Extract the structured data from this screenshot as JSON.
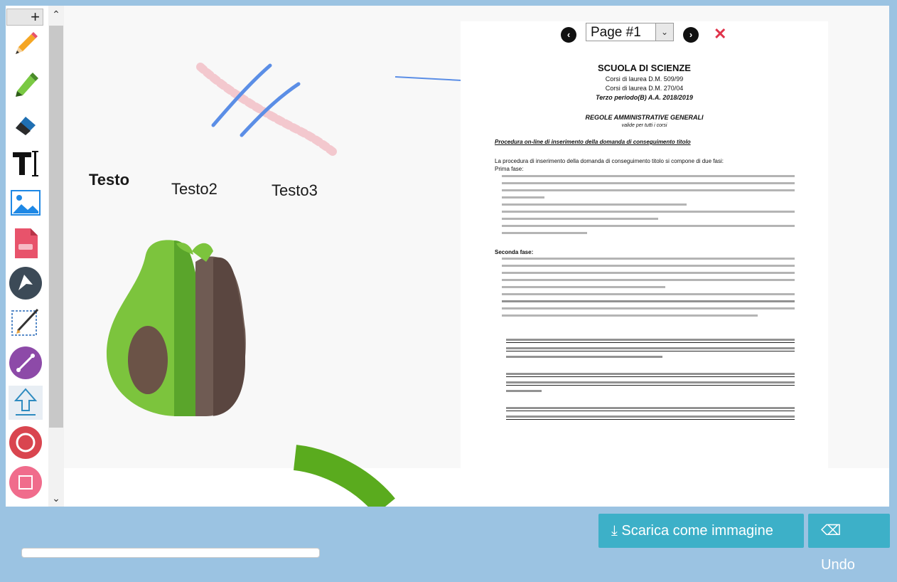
{
  "toolbar": {
    "add_label": "+",
    "tools": [
      {
        "name": "pencil-icon"
      },
      {
        "name": "highlighter-icon"
      },
      {
        "name": "eraser-icon"
      },
      {
        "name": "text-icon"
      },
      {
        "name": "image-icon"
      },
      {
        "name": "pdf-icon"
      },
      {
        "name": "pointer-icon"
      },
      {
        "name": "sketch-icon"
      },
      {
        "name": "line-icon"
      },
      {
        "name": "arrow-up-icon"
      },
      {
        "name": "circle-icon"
      },
      {
        "name": "rectangle-icon"
      }
    ]
  },
  "canvas": {
    "texts": [
      "Testo",
      "Testo2",
      "Testo3"
    ]
  },
  "document": {
    "page_select": "Page #1",
    "title": "SCUOLA DI  SCIENZE",
    "sub1": "Corsi di laurea D.M. 509/99",
    "sub2": "Corsi di laurea D.M. 270/04",
    "sub3": "Terzo  periodo(B) A.A. 2018/2019",
    "rules_title": "REGOLE AMMINISTRATIVE GENERALI",
    "rules_sub": "valide per tutti i corsi",
    "procedure": "Procedura on-line di inserimento della domanda di conseguimento titolo",
    "intro": "La procedura di inserimento della domanda di conseguimento titolo si compone di due fasi:",
    "phase1": "Prima fase:",
    "phase2": "Seconda fase:"
  },
  "footer": {
    "download_label": "Scarica come immagine",
    "undo_label": "Undo"
  },
  "colors": {
    "accent": "#3db0c8",
    "background": "#9bc3e2"
  }
}
